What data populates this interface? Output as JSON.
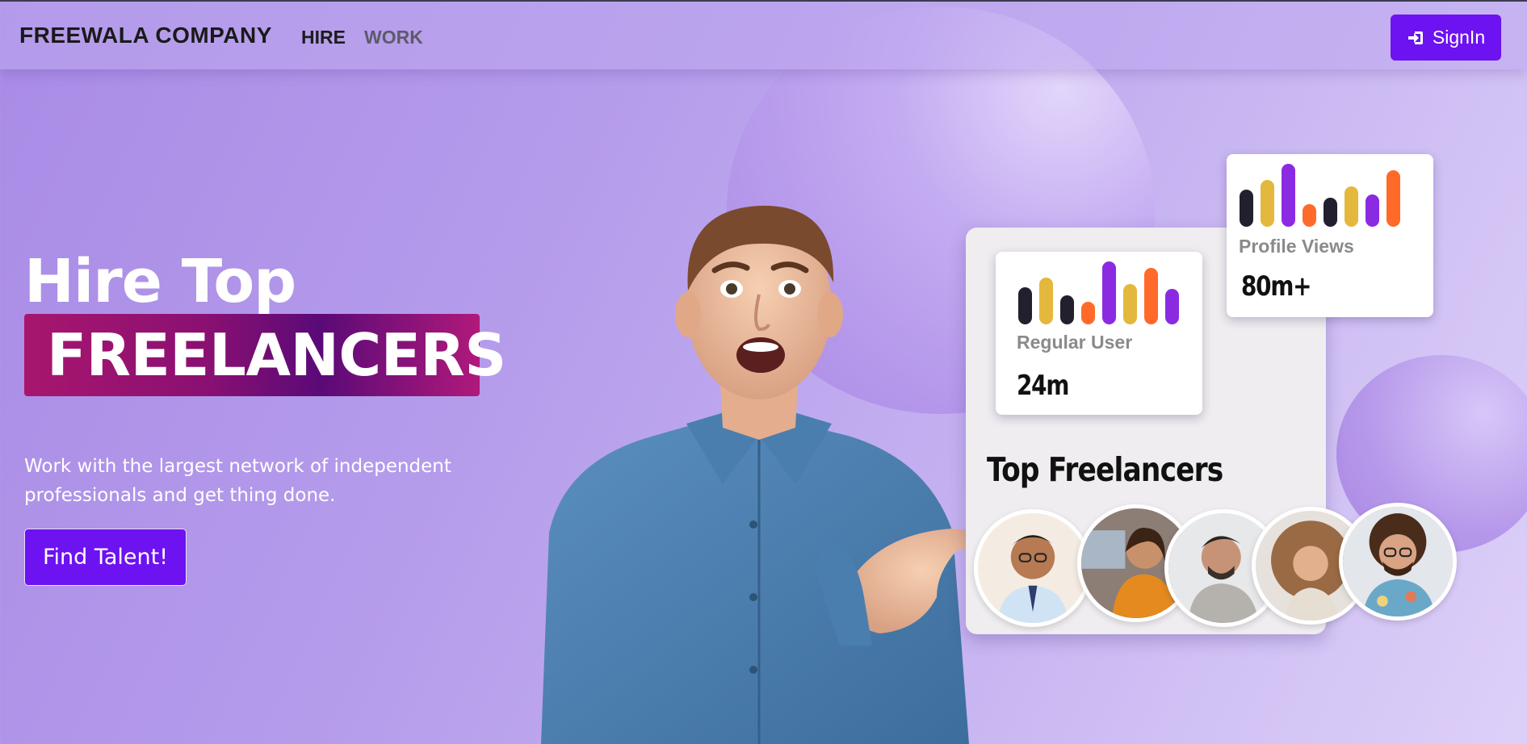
{
  "navbar": {
    "brand": "FREEWALA COMPANY",
    "links": [
      {
        "label": "HIRE",
        "active": true
      },
      {
        "label": "WORK",
        "active": false
      }
    ],
    "signin_label": "SignIn",
    "signin_icon": "sign-in-icon"
  },
  "hero": {
    "line1": "Hire Top",
    "line2": "FREELANCERS",
    "subtitle": "Work with the largest network of independent professionals and get thing done.",
    "cta_label": "Find Talent!"
  },
  "stats": [
    {
      "label": "Regular User",
      "value": "24m"
    },
    {
      "label": "Profile Views",
      "value": "80m+"
    }
  ],
  "top_freelancers": {
    "title": "Top Freelancers",
    "count": 5
  },
  "colors": {
    "accent": "#6d12f0",
    "hero_box_start": "#a8166e",
    "hero_box_mid": "#5a0a78",
    "bar_dark": "#22202e",
    "bar_gold": "#e4b83c",
    "bar_purple": "#8a2be2",
    "bar_orange": "#ff6a2b"
  }
}
